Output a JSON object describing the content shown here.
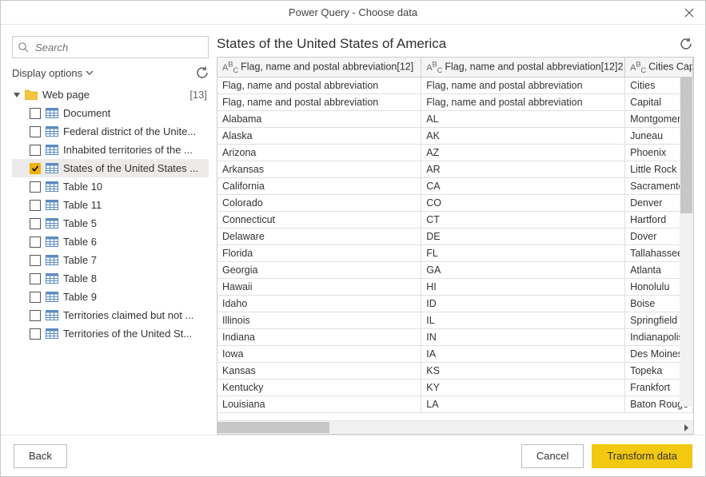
{
  "titlebar": {
    "title": "Power Query - Choose data"
  },
  "sidebar": {
    "search_placeholder": "Search",
    "display_label": "Display options",
    "root": {
      "label": "Web page",
      "count": "[13]"
    },
    "items": [
      {
        "label": "Document",
        "checked": false,
        "selected": false
      },
      {
        "label": "Federal district of the Unite...",
        "checked": false,
        "selected": false
      },
      {
        "label": "Inhabited territories of the ...",
        "checked": false,
        "selected": false
      },
      {
        "label": "States of the United States ...",
        "checked": true,
        "selected": true
      },
      {
        "label": "Table 10",
        "checked": false,
        "selected": false
      },
      {
        "label": "Table 11",
        "checked": false,
        "selected": false
      },
      {
        "label": "Table 5",
        "checked": false,
        "selected": false
      },
      {
        "label": "Table 6",
        "checked": false,
        "selected": false
      },
      {
        "label": "Table 7",
        "checked": false,
        "selected": false
      },
      {
        "label": "Table 8",
        "checked": false,
        "selected": false
      },
      {
        "label": "Table 9",
        "checked": false,
        "selected": false
      },
      {
        "label": "Territories claimed but not ...",
        "checked": false,
        "selected": false
      },
      {
        "label": "Territories of the United St...",
        "checked": false,
        "selected": false
      }
    ]
  },
  "main": {
    "title": "States of the United States of America",
    "columns": [
      {
        "type": "ABC",
        "label": "Flag, name and postal abbreviation[12]"
      },
      {
        "type": "ABC",
        "label": "Flag, name and postal abbreviation[12]2"
      },
      {
        "type": "ABC",
        "label": "Cities Capital"
      }
    ],
    "rows": [
      [
        "Flag, name and postal abbreviation",
        "Flag, name and postal abbreviation",
        "Cities"
      ],
      [
        "Flag, name and postal abbreviation",
        "Flag, name and postal abbreviation",
        "Capital"
      ],
      [
        "Alabama",
        "AL",
        "Montgomery"
      ],
      [
        "Alaska",
        "AK",
        "Juneau"
      ],
      [
        "Arizona",
        "AZ",
        "Phoenix"
      ],
      [
        "Arkansas",
        "AR",
        "Little Rock"
      ],
      [
        "California",
        "CA",
        "Sacramento"
      ],
      [
        "Colorado",
        "CO",
        "Denver"
      ],
      [
        "Connecticut",
        "CT",
        "Hartford"
      ],
      [
        "Delaware",
        "DE",
        "Dover"
      ],
      [
        "Florida",
        "FL",
        "Tallahassee"
      ],
      [
        "Georgia",
        "GA",
        "Atlanta"
      ],
      [
        "Hawaii",
        "HI",
        "Honolulu"
      ],
      [
        "Idaho",
        "ID",
        "Boise"
      ],
      [
        "Illinois",
        "IL",
        "Springfield"
      ],
      [
        "Indiana",
        "IN",
        "Indianapolis"
      ],
      [
        "Iowa",
        "IA",
        "Des Moines"
      ],
      [
        "Kansas",
        "KS",
        "Topeka"
      ],
      [
        "Kentucky",
        "KY",
        "Frankfort"
      ],
      [
        "Louisiana",
        "LA",
        "Baton Rouge"
      ]
    ]
  },
  "footer": {
    "back": "Back",
    "cancel": "Cancel",
    "transform": "Transform data"
  }
}
